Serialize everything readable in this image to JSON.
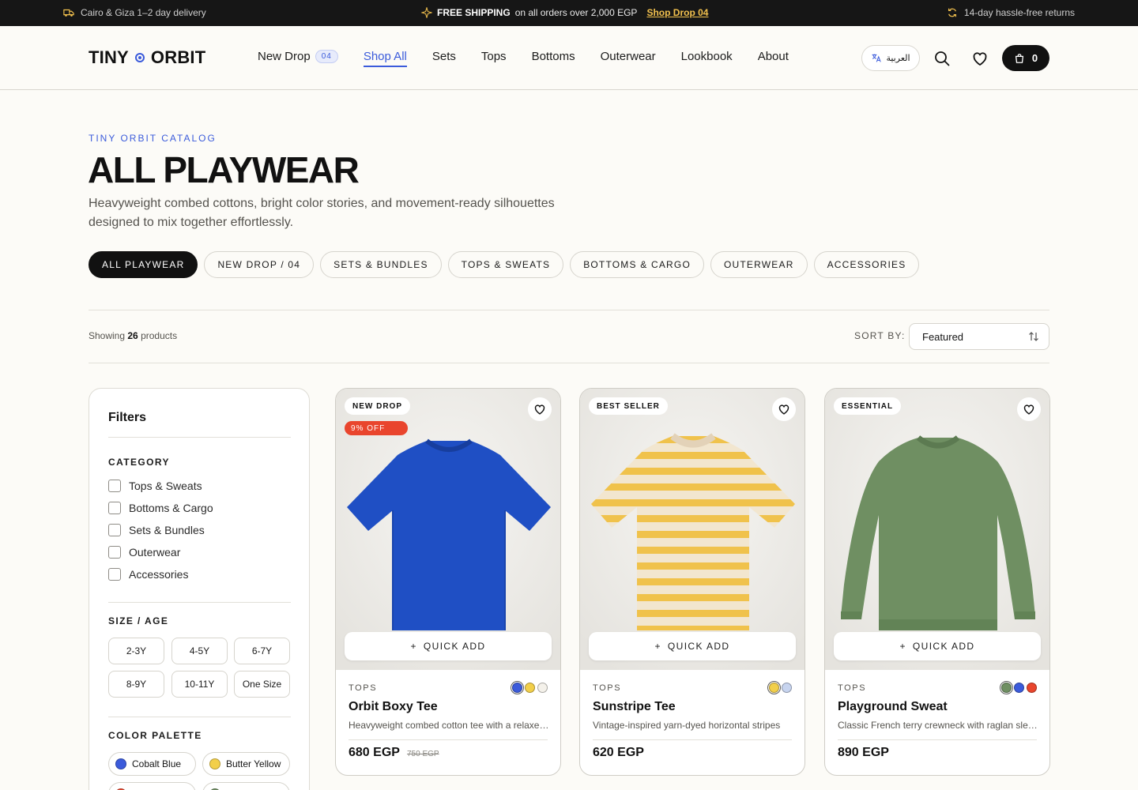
{
  "topbar": {
    "delivery": "Cairo & Giza 1–2 day delivery",
    "shipping_strong": "FREE SHIPPING",
    "shipping_rest": "on all orders over 2,000 EGP",
    "shop_link": "Shop Drop 04",
    "returns": "14-day hassle-free returns"
  },
  "header": {
    "logo_left": "TINY",
    "logo_right": "ORBIT",
    "nav": [
      {
        "label": "New Drop",
        "pill": "04"
      },
      {
        "label": "Shop All"
      },
      {
        "label": "Sets"
      },
      {
        "label": "Tops"
      },
      {
        "label": "Bottoms"
      },
      {
        "label": "Outerwear"
      },
      {
        "label": "Lookbook"
      },
      {
        "label": "About"
      }
    ],
    "language": "العربية",
    "cart_count": "0"
  },
  "hero": {
    "eyebrow": "TINY ORBIT CATALOG",
    "title": "ALL PLAYWEAR",
    "subtitle": "Heavyweight combed cottons, bright color stories, and movement-ready silhouettes designed to mix together effortlessly."
  },
  "chips": [
    "ALL PLAYWEAR",
    "NEW DROP / 04",
    "SETS & BUNDLES",
    "TOPS & SWEATS",
    "BOTTOMS & CARGO",
    "OUTERWEAR",
    "ACCESSORIES"
  ],
  "toolbar": {
    "showing_prefix": "Showing",
    "showing_count": "26",
    "showing_suffix": "products",
    "sort_label": "SORT BY:",
    "sort_value": "Featured"
  },
  "filters": {
    "title": "Filters",
    "category_heading": "CATEGORY",
    "categories": [
      "Tops & Sweats",
      "Bottoms & Cargo",
      "Sets & Bundles",
      "Outerwear",
      "Accessories"
    ],
    "size_heading": "SIZE / AGE",
    "sizes": [
      "2-3Y",
      "4-5Y",
      "6-7Y",
      "8-9Y",
      "10-11Y",
      "One Size"
    ],
    "color_heading": "COLOR PALETTE",
    "colors": [
      {
        "label": "Cobalt Blue",
        "hex": "#3b5bdb"
      },
      {
        "label": "Butter Yellow",
        "hex": "#f2cf4a"
      }
    ]
  },
  "products": [
    {
      "badge": "NEW DROP",
      "discount": "9% OFF",
      "quick_add": "QUICK ADD",
      "category": "TOPS",
      "name": "Orbit Boxy Tee",
      "description": "Heavyweight combed cotton tee with a relaxed boxy fit",
      "price": "680 EGP",
      "old_price": "750 EGP",
      "swatches": [
        "#3b5bdb",
        "#f2cf4a",
        "#f4f1ea"
      ],
      "garment_color": "#1f4fc4"
    },
    {
      "badge": "BEST SELLER",
      "quick_add": "QUICK ADD",
      "category": "TOPS",
      "name": "Sunstripe Tee",
      "description": "Vintage-inspired yarn-dyed horizontal stripes",
      "price": "620 EGP",
      "swatches": [
        "#f2cf4a",
        "#c7d4ef"
      ],
      "garment_color": "#f2e6cf"
    },
    {
      "badge": "ESSENTIAL",
      "quick_add": "QUICK ADD",
      "category": "TOPS",
      "name": "Playground Sweat",
      "description": "Classic French terry crewneck with raglan sleeves",
      "price": "890 EGP",
      "swatches": [
        "#6f8f62",
        "#3b5bdb",
        "#e9452d"
      ],
      "garment_color": "#6f8f62"
    }
  ]
}
